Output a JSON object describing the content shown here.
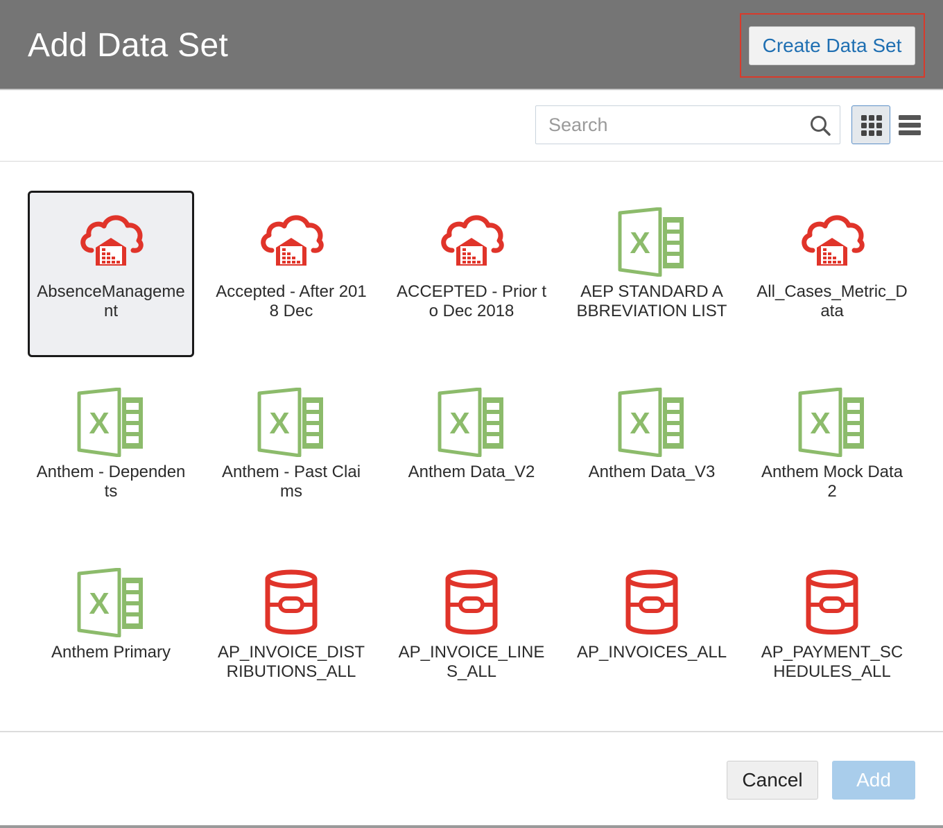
{
  "dialog": {
    "title": "Add Data Set",
    "create_button_label": "Create Data Set"
  },
  "toolbar": {
    "search_placeholder": "Search",
    "search_icon": "search-icon",
    "grid_view_icon": "grid-view-icon",
    "list_view_icon": "list-view-icon",
    "active_view": "grid"
  },
  "colors": {
    "header_bg": "#757575",
    "cloud_red": "#e0342a",
    "excel_green": "#8cbb6b",
    "db_red": "#e0342a",
    "link_blue": "#1f6fb2",
    "add_disabled": "#a9cdeb",
    "highlight": "#d93a2b"
  },
  "datasets": [
    {
      "label": "AbsenceManagement",
      "icon": "cloud-warehouse-icon",
      "selected": true
    },
    {
      "label": "Accepted - After 2018 Dec",
      "icon": "cloud-warehouse-icon",
      "selected": false
    },
    {
      "label": "ACCEPTED - Prior to Dec 2018",
      "icon": "cloud-warehouse-icon",
      "selected": false
    },
    {
      "label": "AEP STANDARD ABBREVIATION LIST",
      "icon": "excel-file-icon",
      "selected": false
    },
    {
      "label": "All_Cases_Metric_Data",
      "icon": "cloud-warehouse-icon",
      "selected": false
    },
    {
      "label": "Anthem - Dependents",
      "icon": "excel-file-icon",
      "selected": false
    },
    {
      "label": "Anthem - Past Claims",
      "icon": "excel-file-icon",
      "selected": false
    },
    {
      "label": "Anthem Data_V2",
      "icon": "excel-file-icon",
      "selected": false
    },
    {
      "label": "Anthem Data_V3",
      "icon": "excel-file-icon",
      "selected": false
    },
    {
      "label": "Anthem Mock Data 2",
      "icon": "excel-file-icon",
      "selected": false
    },
    {
      "label": "Anthem Primary",
      "icon": "excel-file-icon",
      "selected": false
    },
    {
      "label": "AP_INVOICE_DISTRIBUTIONS_ALL",
      "icon": "database-icon",
      "selected": false
    },
    {
      "label": "AP_INVOICE_LINES_ALL",
      "icon": "database-icon",
      "selected": false
    },
    {
      "label": "AP_INVOICES_ALL",
      "icon": "database-icon",
      "selected": false
    },
    {
      "label": "AP_PAYMENT_SCHEDULES_ALL",
      "icon": "database-icon",
      "selected": false
    }
  ],
  "footer": {
    "cancel_label": "Cancel",
    "add_label": "Add"
  }
}
